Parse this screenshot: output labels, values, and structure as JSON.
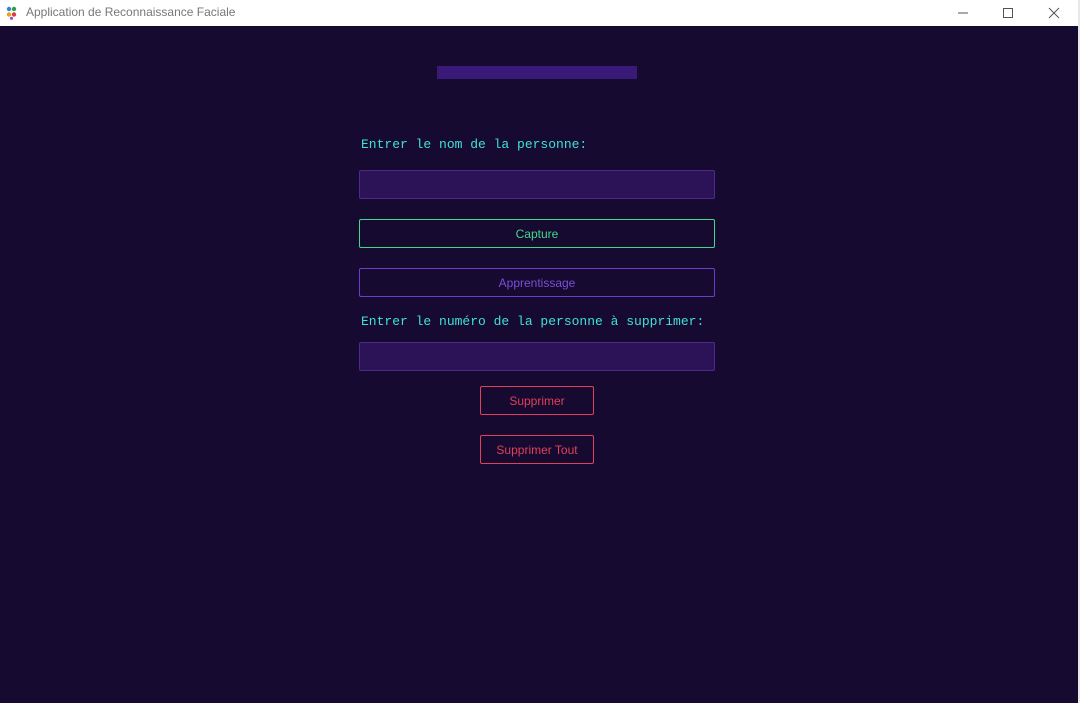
{
  "window": {
    "title": "Application de Reconnaissance Faciale",
    "icons": {
      "app": "app-icon",
      "minimize": "minimize-icon",
      "maximize": "maximize-icon",
      "close": "close-icon"
    }
  },
  "form": {
    "name_label": "Entrer le nom de la personne:",
    "name_value": "",
    "capture_label": "Capture",
    "train_label": "Apprentissage",
    "number_label": "Entrer le numéro de la personne à supprimer:",
    "number_value": "",
    "delete_label": "Supprimer",
    "delete_all_label": "Supprimer Tout"
  },
  "colors": {
    "background": "#170a30",
    "accent_bar": "#3a1a78",
    "label": "#3fe0d6",
    "capture": "#3fd98a",
    "train": "#7a4fd8",
    "delete": "#e0405a",
    "input_bg": "#2c1358"
  }
}
